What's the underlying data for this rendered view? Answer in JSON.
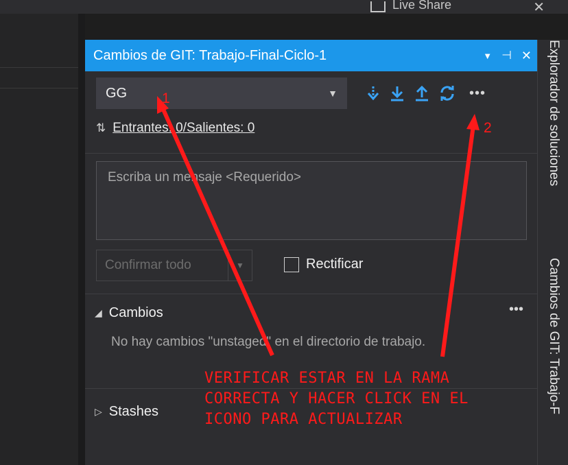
{
  "topbar": {
    "live_share": "Live Share"
  },
  "panel": {
    "title": "Cambios de GIT: Trabajo-Final-Ciclo-1",
    "branch": "GG",
    "incoming_outgoing": "Entrantes: 0/Salientes: 0",
    "message_placeholder": "Escriba un mensaje <Requerido>",
    "commit_button": "Confirmar todo",
    "amend_label": "Rectificar",
    "changes_header": "Cambios",
    "no_changes_text": "No hay cambios \"unstaged\" en el directorio de trabajo.",
    "stashes_header": "Stashes"
  },
  "side_tabs": [
    "Explorador de soluciones",
    "Cambios de GIT: Trabajo-F"
  ],
  "annotations": {
    "marker1": "1",
    "marker2": "2",
    "note_lines": [
      "VERIFICAR ESTAR EN LA RAMA",
      "CORRECTA Y HACER CLICK EN EL",
      "ICONO PARA ACTUALIZAR"
    ]
  },
  "colors": {
    "accent": "#1c97ea",
    "annotation": "#ff1a1a",
    "panel_bg": "#2d2d30"
  },
  "icons": [
    "fetch-icon",
    "pull-icon",
    "push-icon",
    "sync-icon",
    "more-icon"
  ]
}
